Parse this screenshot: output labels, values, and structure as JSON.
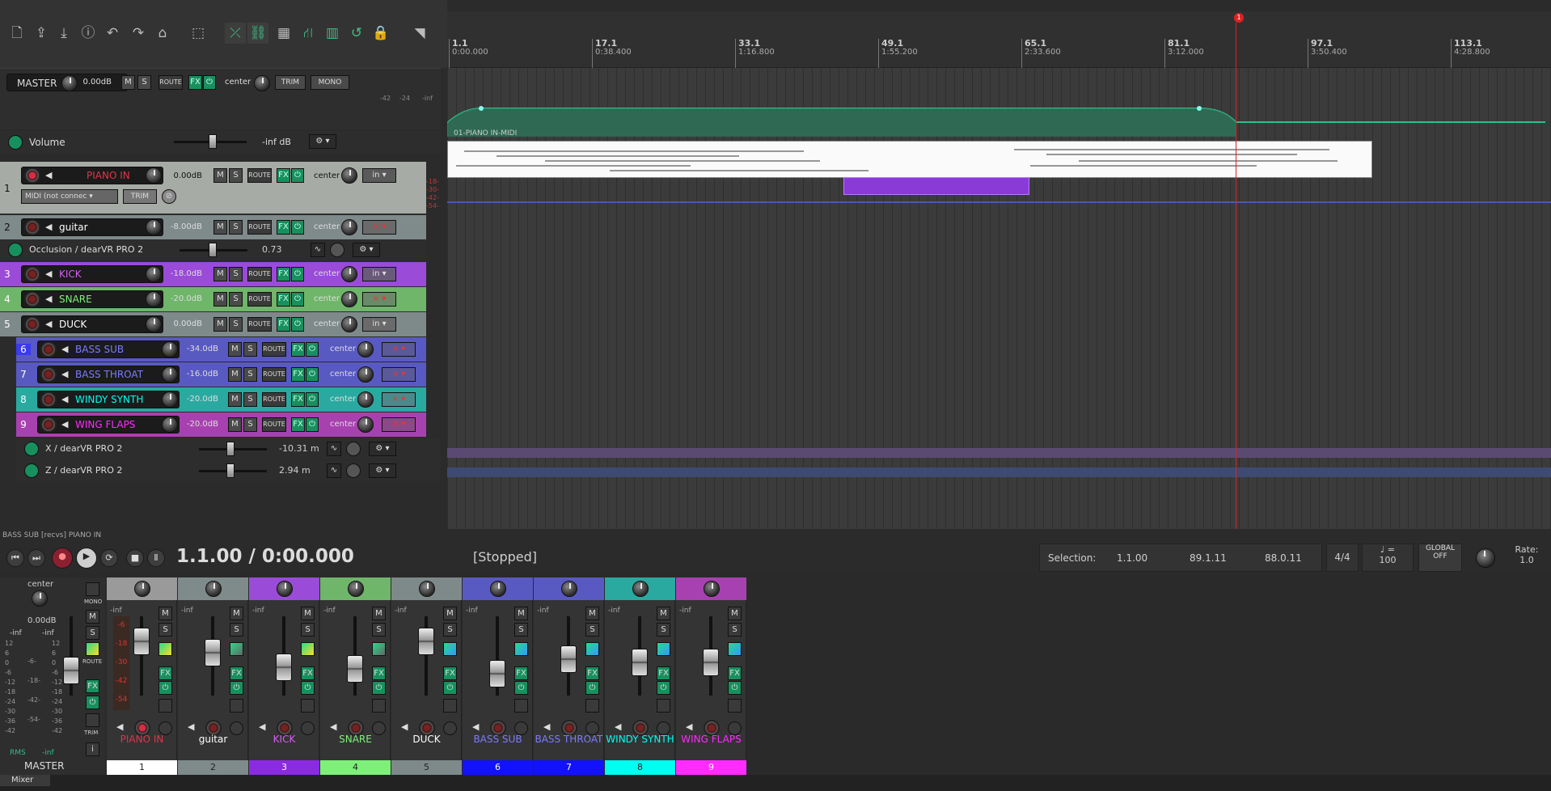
{
  "master": {
    "label": "MASTER",
    "volume": "0.00dB",
    "pan": "center",
    "trim": "TRIM",
    "mono": "MONO",
    "meter_scale": [
      "-42",
      "-24",
      "-inf"
    ]
  },
  "volume_env": {
    "label": "Volume",
    "value": "-inf dB"
  },
  "tracks": [
    {
      "num": "1",
      "name": "PIANO IN",
      "volume": "0.00dB",
      "pan": "center",
      "input": "in",
      "color": "#ffffff",
      "name_color": "#e0354b",
      "midi_label": "MIDI (not connec",
      "trim": "TRIM"
    },
    {
      "num": "2",
      "name": "guitar",
      "volume": "-8.00dB",
      "pan": "center",
      "input": "×",
      "color": "#7f8a8a",
      "name_color": "#ffffff"
    },
    {
      "num": "3",
      "name": "KICK",
      "volume": "-18.0dB",
      "pan": "center",
      "input": "in",
      "color": "#9a4bd8",
      "name_color": "#d35ff0"
    },
    {
      "num": "4",
      "name": "SNARE",
      "volume": "-20.0dB",
      "pan": "center",
      "input": "×",
      "color": "#6fb56a",
      "name_color": "#7ef07a"
    },
    {
      "num": "5",
      "name": "DUCK",
      "volume": "0.00dB",
      "pan": "center",
      "input": "in",
      "color": "#7e8a8a",
      "name_color": "#ffffff"
    },
    {
      "num": "6",
      "name": "BASS SUB",
      "volume": "-34.0dB",
      "pan": "center",
      "input": "×",
      "color": "#5959c2",
      "name_color": "#7b7bff"
    },
    {
      "num": "7",
      "name": "BASS THROAT",
      "volume": "-16.0dB",
      "pan": "center",
      "input": "×",
      "color": "#5959c2",
      "name_color": "#7b7bff"
    },
    {
      "num": "8",
      "name": "WINDY SYNTH",
      "volume": "-20.0dB",
      "pan": "center",
      "input": "×",
      "color": "#2aa9a0",
      "name_color": "#00fff0"
    },
    {
      "num": "9",
      "name": "WING FLAPS",
      "volume": "-20.0dB",
      "pan": "center",
      "input": "×",
      "color": "#a841b0",
      "name_color": "#ff2bff"
    }
  ],
  "envelopes": {
    "occlusion": {
      "label": "Occlusion / dearVR PRO 2",
      "value": "0.73"
    },
    "x": {
      "label": "X / dearVR PRO 2",
      "value": "-10.31 m"
    },
    "z": {
      "label": "Z / dearVR PRO 2",
      "value": "2.94 m"
    }
  },
  "ruler": [
    {
      "bar": "1.1",
      "time": "0:00.000"
    },
    {
      "bar": "17.1",
      "time": "0:38.400"
    },
    {
      "bar": "33.1",
      "time": "1:16.800"
    },
    {
      "bar": "49.1",
      "time": "1:55.200"
    },
    {
      "bar": "65.1",
      "time": "2:33.600"
    },
    {
      "bar": "81.1",
      "time": "3:12.000"
    },
    {
      "bar": "97.1",
      "time": "3:50.400"
    },
    {
      "bar": "113.1",
      "time": "4:28.800"
    }
  ],
  "marker": "1",
  "midi_item": {
    "label": "01-PIANO IN-MIDI"
  },
  "status_line": "BASS SUB [recvs] PIANO IN",
  "transport": {
    "time": "1.1.00 / 0:00.000",
    "state": "[Stopped]",
    "selection_label": "Selection:",
    "sel_start": "1.1.00",
    "sel_end": "89.1.11",
    "sel_len": "88.0.11",
    "time_sig": "4/4",
    "tempo_label": "♩ =",
    "tempo": "100",
    "global_label": "GLOBAL",
    "global_value": "OFF",
    "rate_label": "Rate:",
    "rate": "1.0"
  },
  "mixer": {
    "master_label": "MASTER",
    "master_pan": "center",
    "master_vol": "0.00dB",
    "rms": "RMS",
    "rms_val": "-inf",
    "mono": "MONO",
    "route": "ROUTE",
    "trim": "TRIM",
    "info": "i",
    "inf": "-inf",
    "meter_left": [
      "12",
      "6",
      "0",
      "-6",
      "-12",
      "-18",
      "-24",
      "-30",
      "-36",
      "-42"
    ],
    "meter_right": [
      "12",
      "6",
      "0",
      "-6",
      "-12",
      "-18",
      "-24",
      "-30",
      "-36",
      "-42"
    ],
    "meter_mid": [
      "-6-",
      "-18-",
      "-42-",
      "-54-"
    ],
    "piano_meter": [
      "-6",
      "-18",
      "-30",
      "-42",
      "-54"
    ],
    "tab": "Mixer"
  },
  "buttons": {
    "m": "M",
    "s": "S",
    "route": "ROUTE",
    "fx": "FX",
    "pwr": "⏻"
  }
}
